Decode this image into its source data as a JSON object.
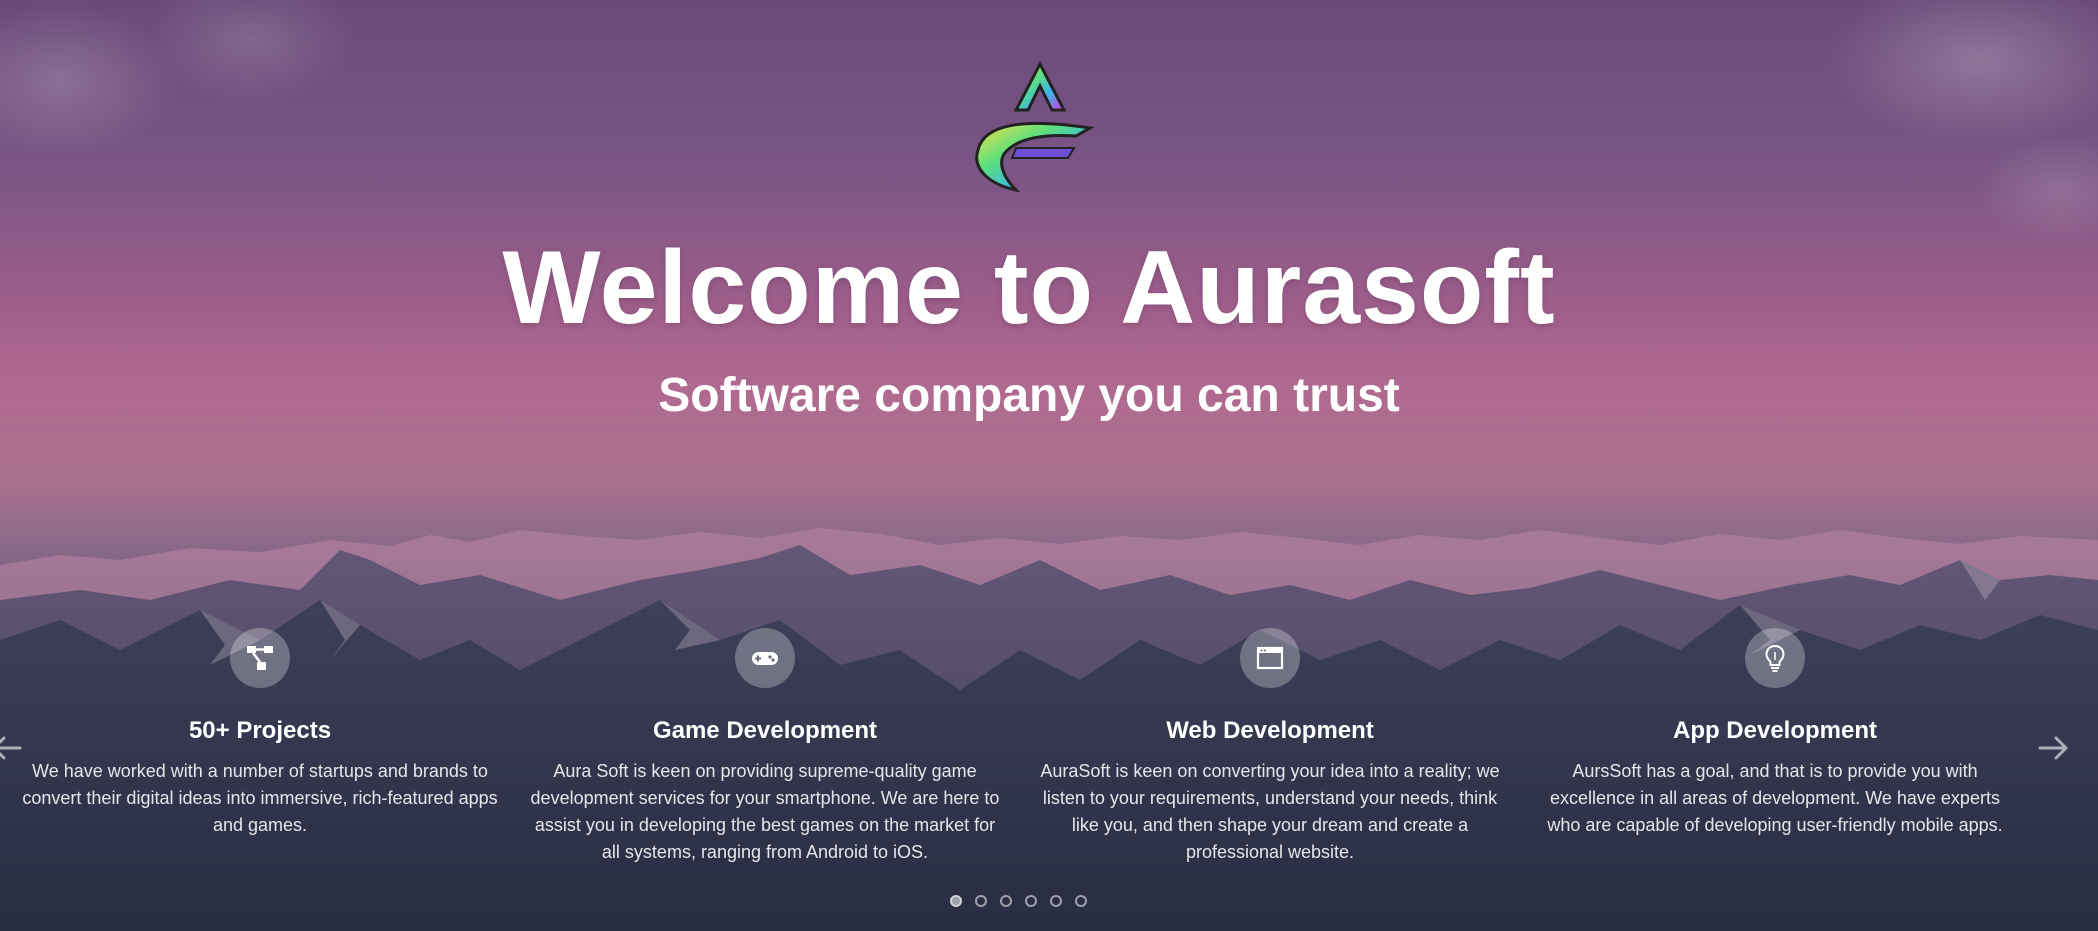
{
  "hero": {
    "title": "Welcome to Aurasoft",
    "subtitle": "Software company you can trust"
  },
  "logo": {
    "icon": "aurasoft-logo"
  },
  "features": [
    {
      "icon": "project-structure-icon",
      "title": "50+ Projects",
      "text": "We have worked with a number of startups and brands to convert their digital ideas into immersive, rich-featured apps and games."
    },
    {
      "icon": "gamepad-icon",
      "title": "Game Development",
      "text": "Aura Soft is keen on providing supreme-quality game development services for your smartphone. We are here to assist you in developing the best games on the market for all systems, ranging from Android to iOS."
    },
    {
      "icon": "browser-window-icon",
      "title": "Web Development",
      "text": "AuraSoft is keen on converting your idea into a reality; we listen to your requirements, understand your needs, think like you, and then shape your dream and create a professional website."
    },
    {
      "icon": "lightbulb-icon",
      "title": "App Development",
      "text": "AursSoft has a goal, and that is to provide you with excellence in all areas of development. We have experts who are capable of developing user-friendly mobile apps."
    }
  ],
  "carousel": {
    "prev_icon": "arrow-left-icon",
    "next_icon": "arrow-right-icon",
    "slide_count": 6,
    "active_slide": 1
  },
  "colors": {
    "sky_top": "#6a4a7a",
    "sky_mid": "#b06a90",
    "mountain_dark": "#2b3248",
    "icon_circle": "rgba(255,255,255,0.28)"
  }
}
